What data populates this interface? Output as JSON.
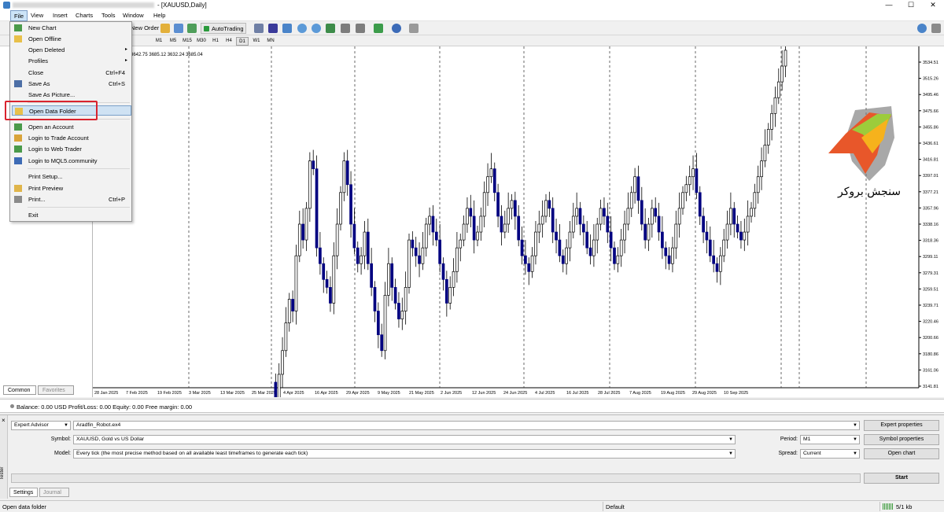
{
  "window": {
    "title": "- [XAUUSD,Daily]",
    "controls": [
      "—",
      "☐",
      "✕"
    ]
  },
  "menubar": [
    "File",
    "View",
    "Insert",
    "Charts",
    "Tools",
    "Window",
    "Help"
  ],
  "toolbar": {
    "new_order": "New Order",
    "autotrading": "AutoTrading",
    "timeframes": [
      "M1",
      "M5",
      "M15",
      "M30",
      "H1",
      "H4",
      "D1",
      "W1",
      "MN"
    ]
  },
  "file_menu": [
    {
      "label": "New Chart",
      "shortcut": "",
      "icon": "new-chart-icon"
    },
    {
      "label": "Open Offline",
      "shortcut": "",
      "icon": "folder-icon"
    },
    {
      "label": "Open Deleted",
      "shortcut": "▸",
      "icon": ""
    },
    {
      "label": "Profiles",
      "shortcut": "▸",
      "icon": ""
    },
    {
      "label": "Close",
      "shortcut": "Ctrl+F4",
      "icon": ""
    },
    {
      "label": "Save As",
      "shortcut": "Ctrl+S",
      "icon": "save-icon"
    },
    {
      "label": "Save As Picture...",
      "shortcut": "",
      "icon": ""
    },
    {
      "label": "Open Data Folder",
      "shortcut": "",
      "icon": "folder-icon"
    },
    {
      "label": "Open an Account",
      "shortcut": "",
      "icon": "account-icon"
    },
    {
      "label": "Login to Trade Account",
      "shortcut": "",
      "icon": "login-icon"
    },
    {
      "label": "Login to Web Trader",
      "shortcut": "",
      "icon": "web-icon"
    },
    {
      "label": "Login to MQL5.community",
      "shortcut": "",
      "icon": "mql5-icon"
    },
    {
      "label": "Print Setup...",
      "shortcut": "",
      "icon": ""
    },
    {
      "label": "Print Preview",
      "shortcut": "",
      "icon": "print-preview-icon"
    },
    {
      "label": "Print...",
      "shortcut": "Ctrl+P",
      "icon": "print-icon"
    },
    {
      "label": "Exit",
      "shortcut": "",
      "icon": ""
    }
  ],
  "navigator": {
    "tab_common": "Common",
    "tab_favorites": "Favorites"
  },
  "chart": {
    "ohlc_header": "3642.75 3685.12 3632.24 3685.04",
    "price_labels": [
      "3534.51",
      "3515.26",
      "3495.46",
      "3475.66",
      "3455.86",
      "3436.61",
      "3416.81",
      "3397.01",
      "3377.21",
      "3357.96",
      "3338.16",
      "3318.36",
      "3299.11",
      "3279.31",
      "3259.51",
      "3239.71",
      "3220.46",
      "3200.66",
      "3180.86",
      "3161.06",
      "3141.81"
    ],
    "date_labels": [
      "28 Jan 2025",
      "7 Feb 2025",
      "19 Feb 2025",
      "3 Mar 2025",
      "13 Mar 2025",
      "25 Mar 2025",
      "4 Apr 2025",
      "16 Apr 2025",
      "29 Apr 2025",
      "9 May 2025",
      "21 May 2025",
      "2 Jun 2025",
      "12 Jun 2025",
      "24 Jun 2025",
      "4 Jul 2025",
      "16 Jul 2025",
      "28 Jul 2025",
      "7 Aug 2025",
      "19 Aug 2025",
      "29 Aug 2025",
      "10 Sep 2025"
    ],
    "bull_color": "#ffffff",
    "bear_color": "#000080"
  },
  "logo": {
    "text": "سنجش بروکر"
  },
  "balance": {
    "text": "Balance: 0.00 USD  Profit/Loss: 0.00  Equity: 0.00  Free margin: 0.00"
  },
  "tester": {
    "type_value": "Expert Advisor",
    "ea_value": "Aradfin_Robot.ex4",
    "symbol_label": "Symbol:",
    "symbol_value": "XAUUSD, Gold vs US Dollar",
    "model_label": "Model:",
    "model_value": "Every tick (the most precise method based on all available least timeframes to generate each tick)",
    "period_label": "Period:",
    "period_value": "M1",
    "spread_label": "Spread:",
    "spread_value": "Current",
    "btn_expert_properties": "Expert properties",
    "btn_symbol_properties": "Symbol properties",
    "btn_open_chart": "Open chart",
    "btn_start": "Start",
    "tab_settings": "Settings",
    "tab_journal": "Journal",
    "side_label": "Tester"
  },
  "statusbar": {
    "left": "Open data folder",
    "profile": "Default",
    "traffic": "5/1 kb"
  }
}
